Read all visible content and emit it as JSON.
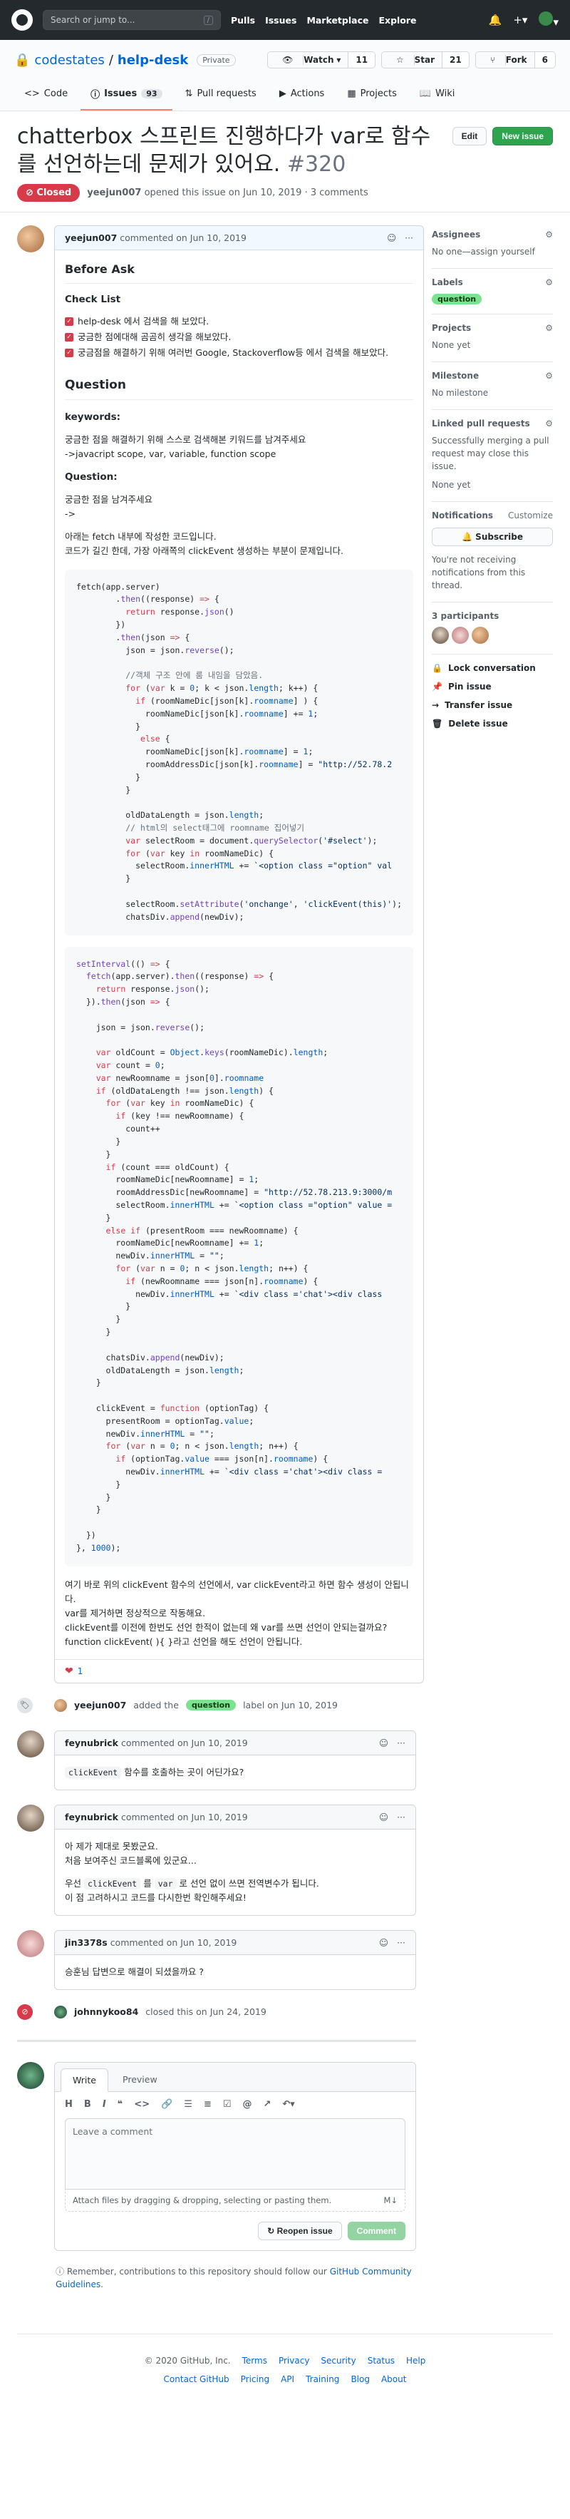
{
  "header": {
    "search_placeholder": "Search or jump to...",
    "search_shortcut": "/",
    "nav": [
      "Pulls",
      "Issues",
      "Marketplace",
      "Explore"
    ]
  },
  "repo": {
    "owner": "codestates",
    "name": "help-desk",
    "visibility": "Private",
    "watch_label": "Watch",
    "watch_count": "11",
    "star_label": "Star",
    "star_count": "21",
    "fork_label": "Fork",
    "fork_count": "6",
    "tabs": [
      {
        "label": "Code"
      },
      {
        "label": "Issues",
        "count": "93"
      },
      {
        "label": "Pull requests"
      },
      {
        "label": "Actions"
      },
      {
        "label": "Projects"
      },
      {
        "label": "Wiki"
      }
    ]
  },
  "issue": {
    "title": "chatterbox 스프린트 진행하다가 var로 함수를 선언하는데 문제가 있어요.",
    "number": "#320",
    "state": "Closed",
    "author": "yeejun007",
    "opened_text": "opened this issue on Jun 10, 2019 · 3 comments",
    "edit_label": "Edit",
    "new_issue_label": "New issue"
  },
  "first_comment": {
    "author": "yeejun007",
    "when": "commented on Jun 10, 2019",
    "before_ask": "Before Ask",
    "checklist_title": "Check List",
    "checklist": [
      "help-desk 에서 검색을 해 보았다.",
      "궁금한 점에대해 곰곰히 생각을 해보았다.",
      "궁금점을 해결하기 위해 여러번 Google, Stackoverflow등 에서 검색을 해보았다."
    ],
    "question_heading": "Question",
    "keywords_label": "keywords:",
    "keywords_hint": "궁금한 점을 해결하기 위해 스스로 검색해본 키워드를 남겨주세요",
    "keywords_value": "->javacript scope, var, variable, function scope",
    "question_label": "Question:",
    "question_hint": "궁금한 점을 남겨주세요",
    "question_arrow": "->",
    "intro_1": "아래는 fetch 내부에 작성한 코드입니다.",
    "intro_2": "코드가 길긴 한데, 가장 아래쪽의 clickEvent 생성하는 부분이 문제입니다.",
    "outro_1": "여기 바로 위의 clickEvent 함수의 선언에서, var clickEvent라고 하면 함수 생성이 안됩니다.",
    "outro_2": "var를 제거하면 정상적으로 작동해요.",
    "outro_3": "clickEvent를 이전에 한번도 선언 한적이 없는데 왜 var를 쓰면 선언이 안되는걸까요?",
    "outro_4": "function clickEvent( ){ }라고 선언을 해도 선언이 안됩니다.",
    "reaction_count": "1"
  },
  "label_event": {
    "actor": "yeejun007",
    "action": "added the",
    "label": "question",
    "suffix": "label on Jun 10, 2019"
  },
  "comment_2": {
    "author": "feynubrick",
    "when": "commented on Jun 10, 2019",
    "code": "clickEvent",
    "text": "함수를 호출하는 곳이 어딘가요?"
  },
  "comment_3": {
    "author": "feynubrick",
    "when": "commented on Jun 10, 2019",
    "line1": "아 제가 제대로 못봤군요.",
    "line2": "처음 보여주신 코드블록에 있군요...",
    "line3_pre": "우선",
    "line3_code": "clickEvent",
    "line3_mid": "를",
    "line3_code2": "var",
    "line3_post": "로 선언 없이 쓰면 전역변수가 됩니다.",
    "line4": "이 점 고려하시고 코드를 다시한번 확인해주세요!"
  },
  "comment_4": {
    "author": "jin3378s",
    "when": "commented on Jun 10, 2019",
    "text": "승훈님 답변으로 해결이 되셨을까요 ?"
  },
  "close_event": {
    "actor": "johnnykoo84",
    "text": "closed this on Jun 24, 2019"
  },
  "form": {
    "write_tab": "Write",
    "preview_tab": "Preview",
    "placeholder": "Leave a comment",
    "attach_text": "Attach files by dragging & dropping, selecting or pasting them.",
    "reopen_label": "Reopen issue",
    "comment_label": "Comment",
    "reminder_pre": "Remember, contributions to this repository should follow our",
    "reminder_link": "GitHub Community Guidelines",
    "reminder_post": "."
  },
  "sidebar": {
    "assignees_title": "Assignees",
    "assignees_text": "No one—assign yourself",
    "labels_title": "Labels",
    "label": "question",
    "projects_title": "Projects",
    "projects_text": "None yet",
    "milestone_title": "Milestone",
    "milestone_text": "No milestone",
    "linked_title": "Linked pull requests",
    "linked_text": "Successfully merging a pull request may close this issue.",
    "linked_none": "None yet",
    "notifications_title": "Notifications",
    "customize": "Customize",
    "subscribe_label": "Subscribe",
    "notifications_text": "You're not receiving notifications from this thread.",
    "participants_title": "3 participants",
    "lock": "Lock conversation",
    "pin": "Pin issue",
    "transfer": "Transfer issue",
    "delete": "Delete issue"
  },
  "footer": {
    "copyright": "© 2020 GitHub, Inc.",
    "row1": [
      "Terms",
      "Privacy",
      "Security",
      "Status",
      "Help"
    ],
    "row2": [
      "Contact GitHub",
      "Pricing",
      "API",
      "Training",
      "Blog",
      "About"
    ]
  },
  "colors": {
    "closed": "#d73a49",
    "label_question": "#7be38f",
    "primary_green": "#2ea44f",
    "link": "#0366d6"
  }
}
